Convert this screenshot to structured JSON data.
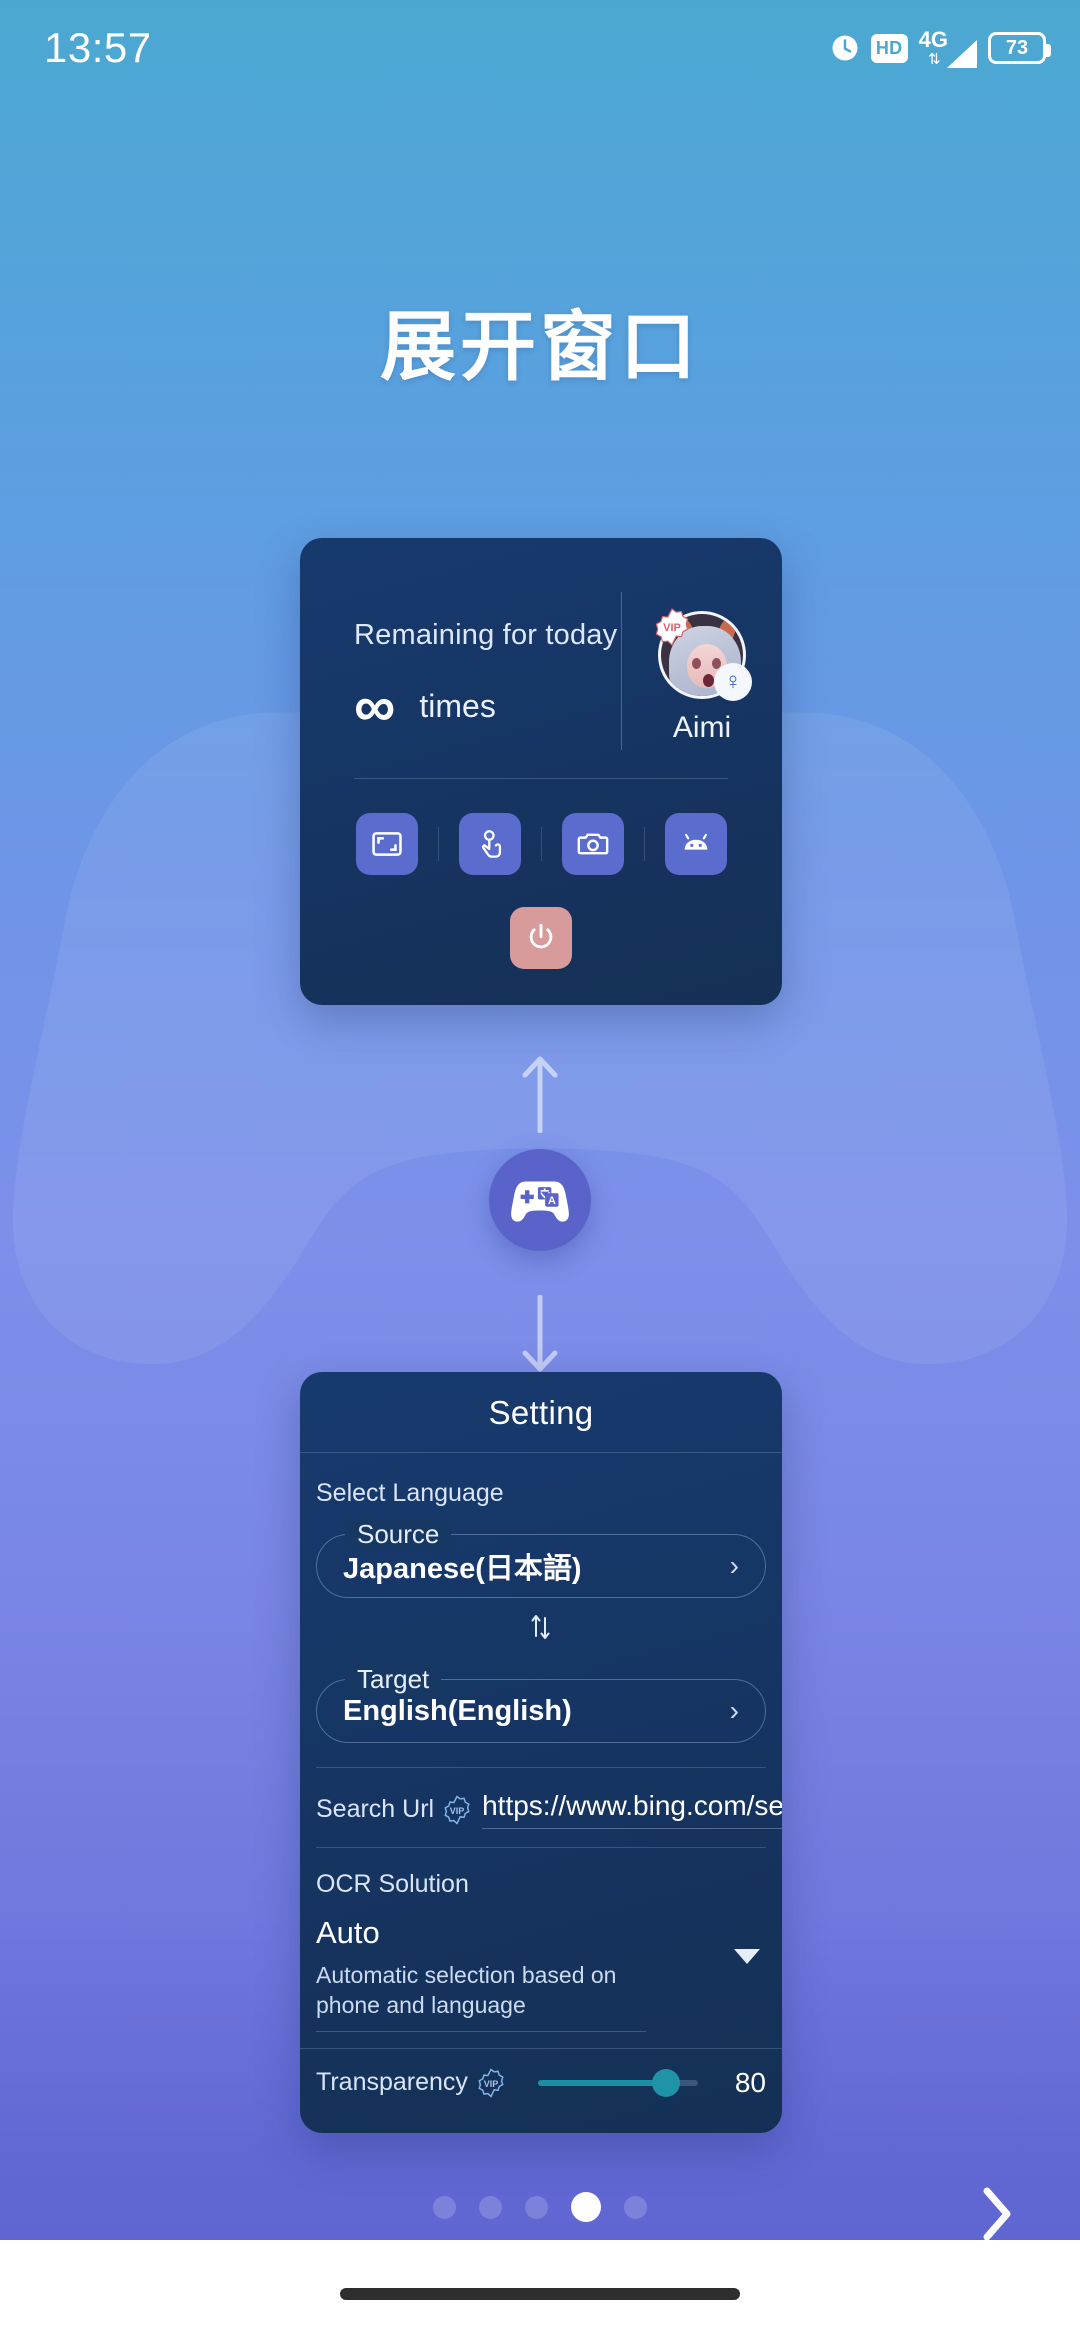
{
  "status_bar": {
    "time": "13:57",
    "alarm_icon": "alarm-clock-icon",
    "hd_label": "HD",
    "network_label": "4G",
    "network_arrows": "⇅",
    "signal_icon": "signal-bars-icon",
    "battery_level": "73"
  },
  "page": {
    "title": "展开窗口"
  },
  "widget_card": {
    "remaining_label": "Remaining for today",
    "count": "∞",
    "count_unit": "times",
    "user": {
      "name": "Aimi",
      "vip_badge": "VIP",
      "gender_symbol": "♀"
    },
    "actions": [
      {
        "name": "resize-window-icon",
        "label": "Resize window"
      },
      {
        "name": "touch-tap-icon",
        "label": "Touch translate"
      },
      {
        "name": "camera-icon",
        "label": "Screenshot translate"
      },
      {
        "name": "android-icon",
        "label": "Android system"
      }
    ],
    "power_button": {
      "name": "power-icon",
      "label": "Stop service"
    }
  },
  "flow": {
    "up_arrow": "↑",
    "down_arrow": "↓",
    "app_logo": "gamepad-translate-logo"
  },
  "setting_card": {
    "header": "Setting",
    "select_language_label": "Select Language",
    "source": {
      "legend": "Source",
      "value": "Japanese(日本語)",
      "chevron": "›"
    },
    "swap_icon": "↑↓",
    "target": {
      "legend": "Target",
      "value": "English(English)",
      "chevron": "›"
    },
    "search_url": {
      "label": "Search Url",
      "vip_badge": "VIP",
      "value": "https://www.bing.com/search"
    },
    "ocr": {
      "section_label": "OCR Solution",
      "selected": "Auto",
      "description": "Automatic selection based on phone and language",
      "caret": "▾"
    },
    "transparency": {
      "label": "Transparency",
      "vip_badge": "VIP",
      "value": "80",
      "percent": 80
    }
  },
  "pager": {
    "total": 5,
    "active_index": 3,
    "next_label": "›"
  },
  "colors": {
    "bg_top": "#4aa8d0",
    "bg_bottom": "#5d63cf",
    "card_bg": "#163863",
    "accent_purple": "#5a63c9",
    "action_btn": "#5a6ccd",
    "power_btn": "#d79b9b",
    "slider_accent": "#1f93a8"
  }
}
